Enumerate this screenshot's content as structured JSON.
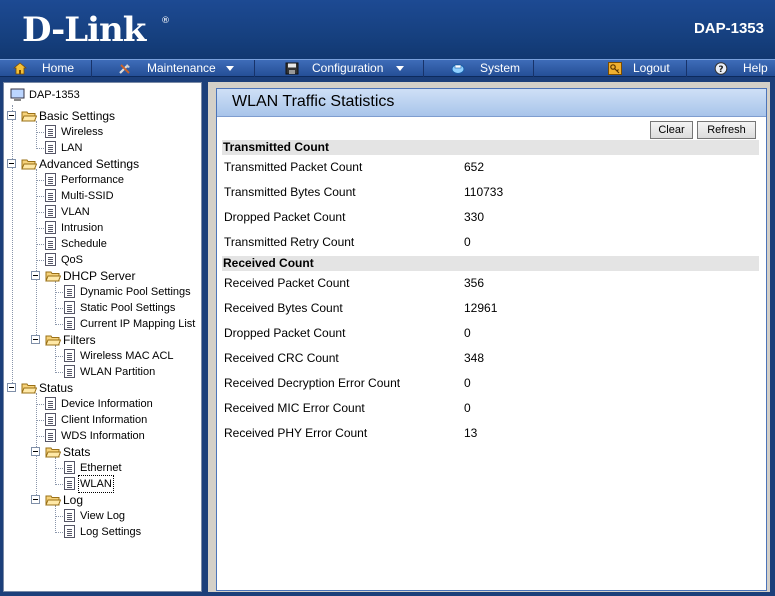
{
  "header": {
    "brand": "D-Link",
    "brand_mark": "®",
    "model": "DAP-1353"
  },
  "menu": [
    {
      "label": "Home",
      "icon": "home-icon"
    },
    {
      "label": "Maintenance",
      "icon": "tools-icon"
    },
    {
      "label": "Configuration",
      "icon": "disk-icon"
    },
    {
      "label": "System",
      "icon": "system-icon"
    },
    {
      "label": "Logout",
      "icon": "key-icon"
    },
    {
      "label": "Help",
      "icon": "help-icon"
    }
  ],
  "tree": {
    "root": "DAP-1353",
    "basic": {
      "label": "Basic Settings",
      "items": [
        "Wireless",
        "LAN"
      ]
    },
    "advanced": {
      "label": "Advanced Settings",
      "items": [
        "Performance",
        "Multi-SSID",
        "VLAN",
        "Intrusion",
        "Schedule",
        "QoS"
      ],
      "dhcp": {
        "label": "DHCP Server",
        "items": [
          "Dynamic Pool Settings",
          "Static Pool Settings",
          "Current IP Mapping List"
        ]
      },
      "filters": {
        "label": "Filters",
        "items": [
          "Wireless MAC ACL",
          "WLAN Partition"
        ]
      }
    },
    "status": {
      "label": "Status",
      "items": [
        "Device Information",
        "Client Information",
        "WDS Information"
      ],
      "stats": {
        "label": "Stats",
        "items": [
          "Ethernet",
          "WLAN"
        ]
      },
      "log": {
        "label": "Log",
        "items": [
          "View Log",
          "Log Settings"
        ]
      }
    }
  },
  "panel": {
    "title": "WLAN Traffic Statistics",
    "buttons": {
      "clear": "Clear",
      "refresh": "Refresh"
    },
    "transmitted": {
      "heading": "Transmitted Count",
      "rows": [
        {
          "label": "Transmitted Packet Count",
          "value": "652"
        },
        {
          "label": "Transmitted Bytes Count",
          "value": "110733"
        },
        {
          "label": "Dropped Packet Count",
          "value": "330"
        },
        {
          "label": "Transmitted Retry Count",
          "value": "0"
        }
      ]
    },
    "received": {
      "heading": "Received Count",
      "rows": [
        {
          "label": "Received Packet Count",
          "value": "356"
        },
        {
          "label": "Received Bytes Count",
          "value": "12961"
        },
        {
          "label": "Dropped Packet Count",
          "value": "0"
        },
        {
          "label": "Received CRC Count",
          "value": "348"
        },
        {
          "label": "Received Decryption Error Count",
          "value": "0"
        },
        {
          "label": "Received MIC Error Count",
          "value": "0"
        },
        {
          "label": "Received PHY Error Count",
          "value": "13"
        }
      ]
    }
  },
  "colors": {
    "header_blue": "#16407f",
    "menu_blue": "#2d5aa5",
    "panel_border": "#4c74b9",
    "section_gray": "#e4e4e4"
  }
}
